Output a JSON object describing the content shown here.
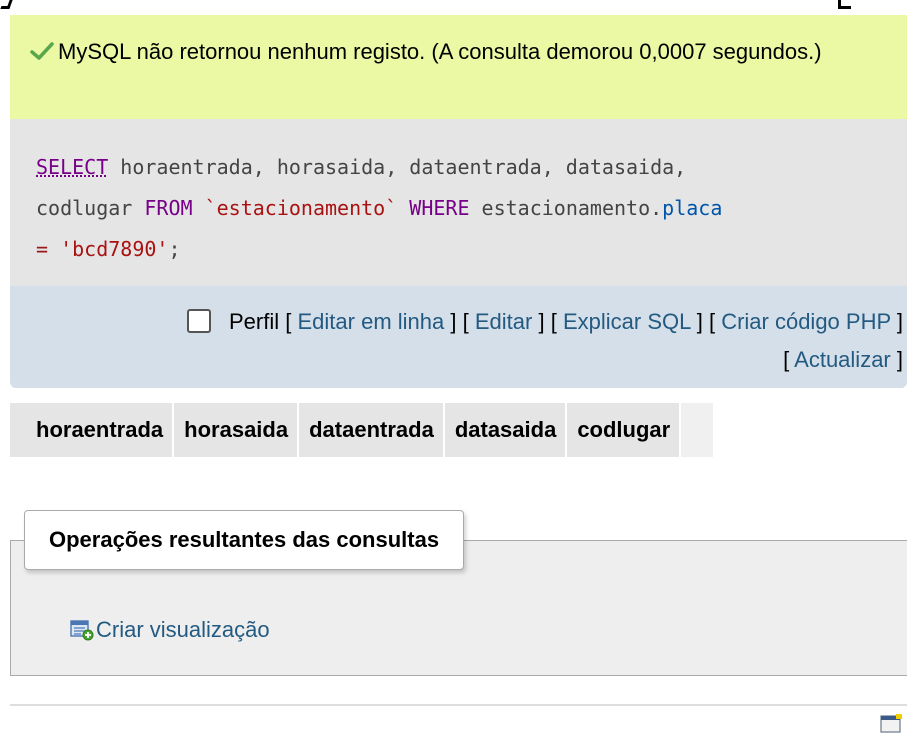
{
  "message": {
    "text": "MySQL não retornou nenhum registo. (A consulta demorou 0,0007 segundos.)",
    "icon": "check-icon",
    "background": "#ebf8a4"
  },
  "sql": {
    "select": "SELECT",
    "columns": " horaentrada, horasaida, dataentrada, datasaida,",
    "codlugar": "codlugar ",
    "from": "FROM",
    "table": " `estacionamento` ",
    "where": "WHERE",
    "expr_table": " estacionamento.",
    "expr_field": "placa",
    "op": "=",
    "value": " 'bcd7890'",
    "semicolon": ";"
  },
  "toolbar": {
    "profile_label": "Perfil",
    "edit_inline": "Editar em linha",
    "edit": "Editar",
    "explain": "Explicar SQL",
    "create_php": "Criar código PHP",
    "refresh": "Actualizar"
  },
  "results": {
    "columns": [
      "horaentrada",
      "horasaida",
      "dataentrada",
      "datasaida",
      "codlugar"
    ]
  },
  "operations": {
    "legend": "Operações resultantes das consultas",
    "create_view": "Criar visualização"
  }
}
